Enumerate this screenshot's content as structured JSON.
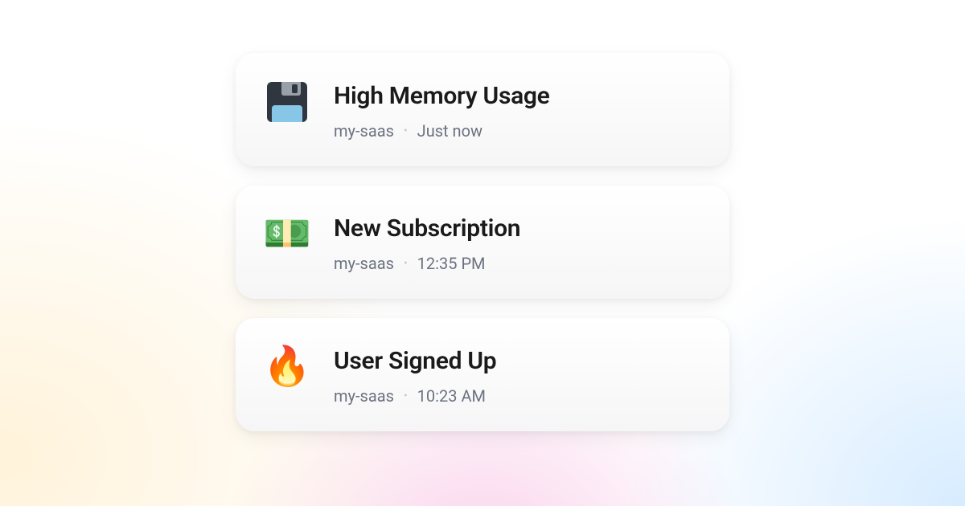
{
  "notifications": [
    {
      "icon_name": "floppy-disk-icon",
      "icon_type": "css",
      "title": "High Memory Usage",
      "project": "my-saas",
      "time": "Just now"
    },
    {
      "icon_name": "money-icon",
      "icon_type": "emoji",
      "icon_glyph": "💵",
      "title": "New Subscription",
      "project": "my-saas",
      "time": "12:35 PM"
    },
    {
      "icon_name": "fire-icon",
      "icon_type": "emoji",
      "icon_glyph": "🔥",
      "title": "User Signed Up",
      "project": "my-saas",
      "time": "10:23 AM"
    }
  ]
}
